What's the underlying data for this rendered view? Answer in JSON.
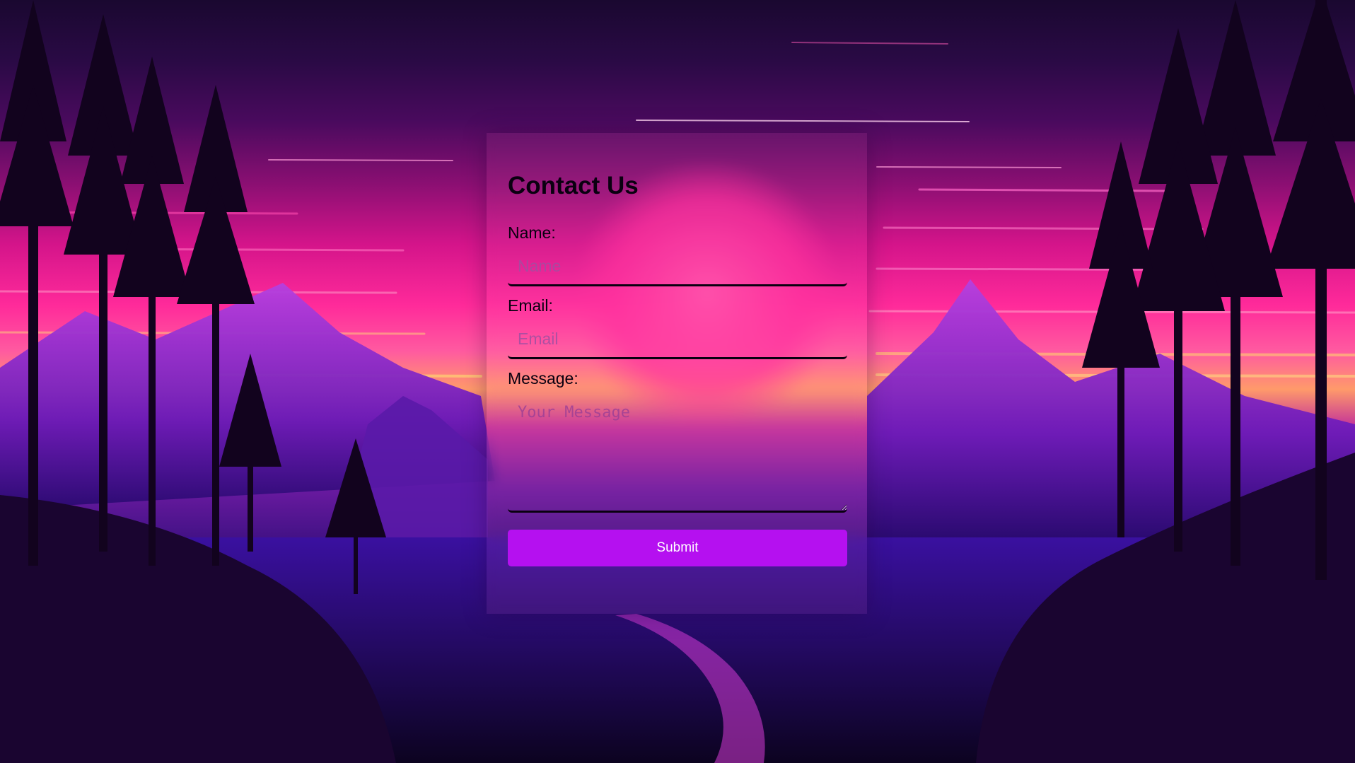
{
  "form": {
    "title": "Contact Us",
    "name_label": "Name:",
    "name_placeholder": "Name",
    "email_label": "Email:",
    "email_placeholder": "Email",
    "message_label": "Message:",
    "message_placeholder": "Your Message",
    "submit_label": "Submit"
  },
  "colors": {
    "submit_button": "#b510f0",
    "text": "#0a0010",
    "sky_pink": "#ff2a9a",
    "mountain_purple": "#7a1fc8"
  },
  "background": {
    "icon": "synthwave-mountain-landscape"
  }
}
